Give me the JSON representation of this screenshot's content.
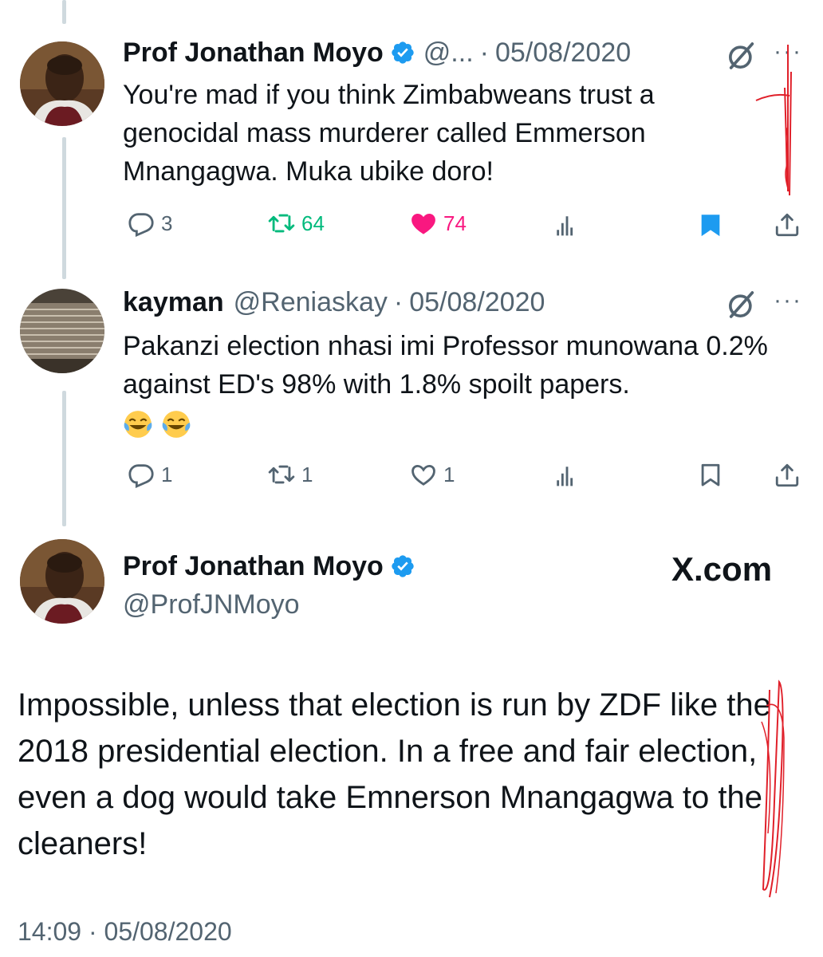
{
  "tweet1": {
    "name": "Prof Jonathan Moyo",
    "handle": "@...",
    "date_sep": "·",
    "date": "05/08/2020",
    "more": "···",
    "text": "You're mad if you think Zimbabweans trust a genocidal mass murderer called Emmerson Mnangagwa. Muka ubike doro!",
    "replies": "3",
    "retweets": "64",
    "likes": "74",
    "colors": {
      "retweet": "#00ba7c",
      "like": "#f91880",
      "bookmark": "#1d9bf0"
    }
  },
  "tweet2": {
    "name": "kayman",
    "handle": "@Reniaskay",
    "date_sep": "·",
    "date": "05/08/2020",
    "more": "···",
    "text": "Pakanzi election nhasi imi Professor munowana 0.2% against ED's 98% with 1.8% spoilt papers.",
    "emojis": [
      "face-with-tears-of-joy",
      "face-with-tears-of-joy"
    ],
    "replies": "1",
    "retweets": "1",
    "likes": "1"
  },
  "main": {
    "name": "Prof Jonathan Moyo",
    "handle": "@ProfJNMoyo",
    "brand": "X.com",
    "text": "Impossible, unless that election is run by ZDF like the 2018 presidential  election. In a free and fair election, even a dog would take Emnerson Mnangagwa to the cleaners!",
    "time": "14:09",
    "date_sep": "·",
    "date": "05/08/2020"
  },
  "colors": {
    "verified": "#1d9bf0",
    "text": "#0f1419",
    "muted": "#536471",
    "annotation": "#e0202a"
  }
}
